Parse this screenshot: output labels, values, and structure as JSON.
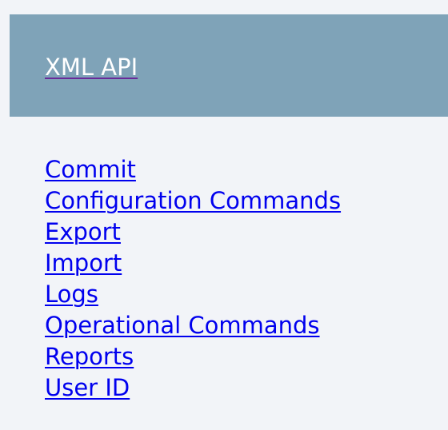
{
  "header": {
    "title_link": "XML API"
  },
  "nav": {
    "items": [
      {
        "label": "Commit"
      },
      {
        "label": "Configuration Commands"
      },
      {
        "label": "Export"
      },
      {
        "label": "Import"
      },
      {
        "label": "Logs"
      },
      {
        "label": "Operational Commands"
      },
      {
        "label": "Reports"
      },
      {
        "label": "User ID"
      }
    ]
  },
  "colors": {
    "page_background": "#f2f4f8",
    "header_background": "#7fa3b8",
    "header_link": "#ffffff",
    "link": "#0000ee"
  }
}
